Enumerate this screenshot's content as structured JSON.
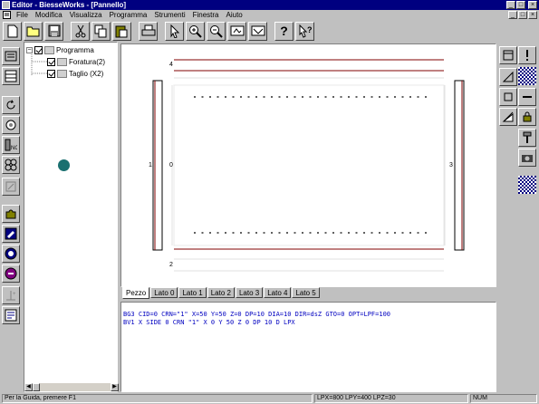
{
  "window": {
    "title": "Editor - BiesseWorks - [Pannello]",
    "controls": [
      "_",
      "□",
      "×"
    ]
  },
  "menubar": {
    "items": [
      "File",
      "Modifica",
      "Visualizza",
      "Programma",
      "Strumenti",
      "Finestra",
      "Aiuto"
    ]
  },
  "toolbar": {
    "buttons": [
      "new-file",
      "open-file",
      "save-file",
      "cut",
      "copy",
      "paste",
      "print",
      "select-tool",
      "zoom-in",
      "zoom-out",
      "zoom-fit",
      "zoom-previous",
      "help",
      "context-help"
    ]
  },
  "tree": {
    "root_sign": "−",
    "items": [
      {
        "label": "Programma"
      },
      {
        "label": "Foratura(2)"
      },
      {
        "label": "Taglio (X2)"
      }
    ]
  },
  "drawing": {
    "side_labels": {
      "top": "4",
      "left_outer": "1",
      "left_inner": "0",
      "right": "3",
      "bottom": "2"
    }
  },
  "tabs": [
    "Pezzo",
    "Lato 0",
    "Lato 1",
    "Lato 2",
    "Lato 3",
    "Lato 4",
    "Lato 5"
  ],
  "active_tab": "Pezzo",
  "code": {
    "lines": [
      "BG3 CID=0 CRN=\"1\" X=50 Y=50 Z=0 DP=10 DIA=10 DIR=dsZ GTO=0 OPT=LPF=100",
      "BV1 X SIDE 0 CRN \"1\" X 0 Y 50 Z 0 DP 10 D LPX"
    ]
  },
  "status": {
    "message": "Per la Guida, premere F1",
    "coords": "LPX=800 LPY=400 LPZ=30",
    "indicators": "NUM"
  },
  "colors": {
    "title_bar": "#000080",
    "panel_outline": "#800000",
    "code_text": "#0000c0",
    "marker": "#1a7070"
  }
}
